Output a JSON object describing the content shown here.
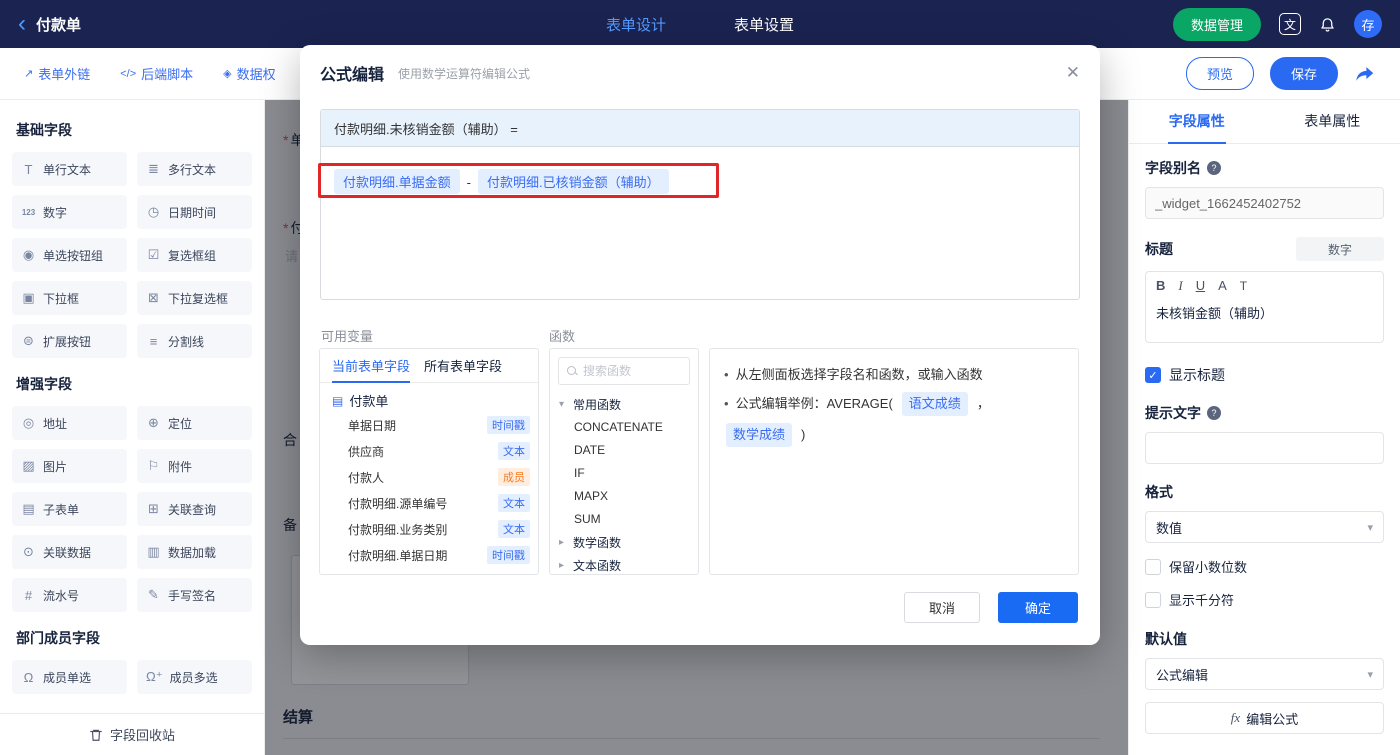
{
  "icons": {
    "back": "‹",
    "language": "文",
    "close": "✕",
    "chevron_down": "▾",
    "chevron_right": "▸",
    "select_chevron": "▾",
    "doc": "▤",
    "bullet": "•",
    "check": "✓",
    "question": "?",
    "fx": "fx",
    "required_asterisk": "*"
  },
  "topbar": {
    "title": "付款单",
    "tabs": [
      {
        "label": "表单设计",
        "active": true
      },
      {
        "label": "表单设置",
        "active": false
      }
    ],
    "data_manage_button": "数据管理",
    "avatar_text": "存"
  },
  "toolbar": {
    "left_items": [
      {
        "icon": "↗",
        "label": "表单外链"
      },
      {
        "icon": "</>",
        "label": "后端脚本"
      },
      {
        "icon": "◈",
        "label": "数据权"
      }
    ],
    "preview_button": "预览",
    "save_button": "保存"
  },
  "left_sidebar": {
    "sections": [
      {
        "title": "基础字段",
        "fields": [
          {
            "icon": "T",
            "label": "单行文本"
          },
          {
            "icon": "≣",
            "label": "多行文本"
          },
          {
            "icon": "123",
            "label": "数字"
          },
          {
            "icon": "◷",
            "label": "日期时间"
          },
          {
            "icon": "◉",
            "label": "单选按钮组"
          },
          {
            "icon": "☑",
            "label": "复选框组"
          },
          {
            "icon": "▣",
            "label": "下拉框"
          },
          {
            "icon": "⊠",
            "label": "下拉复选框"
          },
          {
            "icon": "⊜",
            "label": "扩展按钮"
          },
          {
            "icon": "≡",
            "label": "分割线"
          }
        ]
      },
      {
        "title": "增强字段",
        "fields": [
          {
            "icon": "◎",
            "label": "地址"
          },
          {
            "icon": "⊕",
            "label": "定位"
          },
          {
            "icon": "▨",
            "label": "图片"
          },
          {
            "icon": "⚐",
            "label": "附件"
          },
          {
            "icon": "▤",
            "label": "子表单"
          },
          {
            "icon": "⊞",
            "label": "关联查询"
          },
          {
            "icon": "⊙",
            "label": "关联数据"
          },
          {
            "icon": "▥",
            "label": "数据加载"
          },
          {
            "icon": "#",
            "label": "流水号"
          },
          {
            "icon": "✎",
            "label": "手写签名"
          }
        ]
      },
      {
        "title": "部门成员字段",
        "fields": [
          {
            "icon": "Ω",
            "label": "成员单选"
          },
          {
            "icon": "Ω⁺",
            "label": "成员多选"
          }
        ]
      }
    ],
    "recycle_bin": "字段回收站"
  },
  "canvas": {
    "fragments": [
      "单",
      "付",
      "请",
      "合",
      "备"
    ],
    "section_label": "结算"
  },
  "modal": {
    "title": "公式编辑",
    "subtitle": "使用数学运算符编辑公式",
    "formula_target": "付款明细.未核销金额（辅助） =",
    "formula_tokens": {
      "left": "付款明细.单据金额",
      "operator": "-",
      "right": "付款明细.已核销金额（辅助）"
    },
    "variables": {
      "label": "可用变量",
      "tabs": [
        "当前表单字段",
        "所有表单字段"
      ],
      "root": "付款单",
      "items": [
        {
          "name": "单据日期",
          "tag": "时间戳"
        },
        {
          "name": "供应商",
          "tag": "文本"
        },
        {
          "name": "付款人",
          "tag": "成员"
        },
        {
          "name": "付款明细.源单编号",
          "tag": "文本"
        },
        {
          "name": "付款明细.业务类别",
          "tag": "文本"
        },
        {
          "name": "付款明细.单据日期",
          "tag": "时间戳"
        }
      ]
    },
    "functions": {
      "label": "函数",
      "search_placeholder": "搜索函数",
      "groups": [
        {
          "name": "常用函数",
          "items": [
            "CONCATENATE",
            "DATE",
            "IF",
            "MAPX",
            "SUM"
          ]
        },
        {
          "name": "数学函数",
          "items": []
        },
        {
          "name": "文本函数",
          "items": []
        }
      ]
    },
    "help": {
      "line1": "从左侧面板选择字段名和函数，或输入函数",
      "line2_prefix": "公式编辑举例：AVERAGE(",
      "token1": "语文成绩",
      "separator": "，",
      "token2": "数学成绩",
      "line2_suffix": ")"
    },
    "cancel_button": "取消",
    "confirm_button": "确定"
  },
  "right_sidebar": {
    "tabs": [
      "字段属性",
      "表单属性"
    ],
    "alias_label": "字段别名",
    "alias_value": "_widget_1662452402752",
    "title_label": "标题",
    "title_type": "数字",
    "editor_toolbar": [
      "B",
      "I",
      "U",
      "A",
      "T"
    ],
    "title_value": "未核销金额（辅助）",
    "show_title": "显示标题",
    "hint_label": "提示文字",
    "format_label": "格式",
    "format_value": "数值",
    "keep_decimal": "保留小数位数",
    "thousand_separator": "显示千分符",
    "default_label": "默认值",
    "default_value": "公式编辑",
    "edit_formula_button": "编辑公式"
  },
  "colors": {
    "topbar_bg": "#1b2351",
    "accent_blue": "#2a6af3",
    "green_button": "#0aa665",
    "token_bg": "#e3eeff",
    "token_text": "#3a6df0",
    "tag_orange_bg": "#ffeee0",
    "tag_orange_text": "#f97b22",
    "annotation_red": "#e02626"
  }
}
